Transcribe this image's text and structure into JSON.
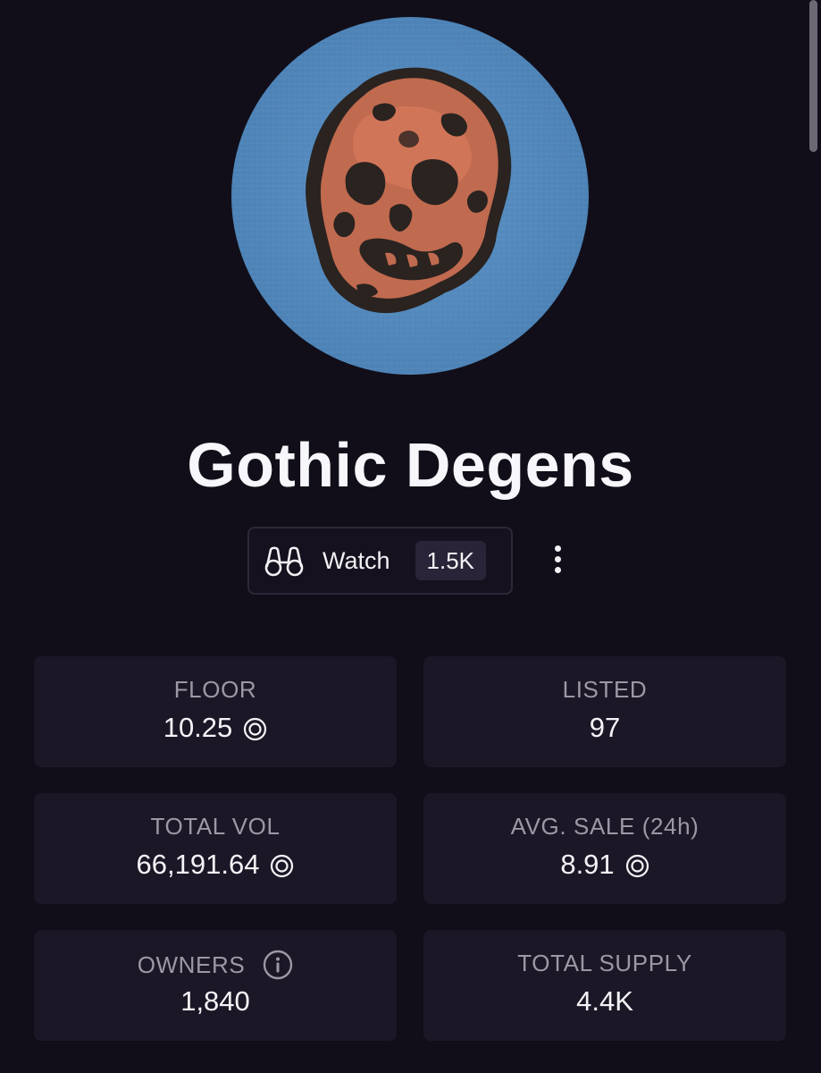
{
  "collection": {
    "name": "Gothic Degens"
  },
  "watch": {
    "label": "Watch",
    "count": "1.5K"
  },
  "icons": {
    "watch": "binoculars-icon",
    "more": "more-vertical-icon",
    "currency": "sol-currency-icon",
    "info": "info-icon"
  },
  "colors": {
    "background": "#110e19",
    "card": "#1c1726",
    "label": "#9c98a6",
    "value": "#f4f3f7",
    "badge": "#2a2438"
  },
  "stats": {
    "floor": {
      "label": "FLOOR",
      "value": "10.25"
    },
    "listed": {
      "label": "LISTED",
      "value": "97"
    },
    "total_vol": {
      "label": "TOTAL VOL",
      "value": "66,191.64"
    },
    "avg_sale": {
      "label": "AVG. SALE (24h)",
      "value": "8.91"
    },
    "owners": {
      "label": "OWNERS",
      "value": "1,840"
    },
    "total_supply": {
      "label": "TOTAL SUPPLY",
      "value": "4.4K"
    }
  }
}
